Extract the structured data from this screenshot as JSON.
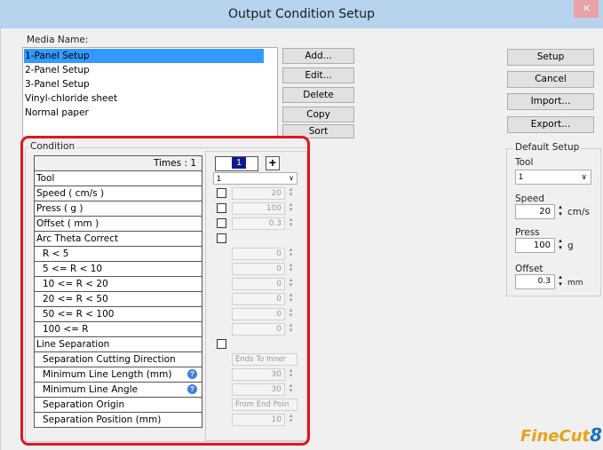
{
  "window": {
    "title": "Output Condition Setup",
    "close_glyph": "✕"
  },
  "media": {
    "label": "Media Name:",
    "items": [
      "1-Panel Setup",
      "2-Panel Setup",
      "3-Panel Setup",
      "Vinyl-chloride sheet",
      "Normal paper"
    ],
    "selected_index": 0
  },
  "list_buttons": {
    "add": "Add...",
    "edit": "Edit...",
    "delete": "Delete",
    "copy": "Copy",
    "sort": "Sort"
  },
  "right_buttons": {
    "setup": "Setup",
    "cancel": "Cancel",
    "import": "Import...",
    "export": "Export..."
  },
  "condition": {
    "group_label": "Condition",
    "times_label": "Times : 1",
    "pass_number": "1",
    "add_pass_glyph": "+",
    "rows": {
      "tool": "Tool",
      "speed": "Speed ( cm/s )",
      "press": "Press ( g )",
      "offset": "Offset ( mm )",
      "arc": "Arc Theta Correct",
      "r1": "R < 5",
      "r2": "5 <= R < 10",
      "r3": "10 <= R < 20",
      "r4": "20 <= R < 50",
      "r5": "50 <= R < 100",
      "r6": "100 <= R",
      "line_sep": "Line Separation",
      "sep_dir": "Separation Cutting Direction",
      "min_len": "Minimum Line Length (mm)",
      "min_angle": "Minimum Line Angle",
      "sep_origin": "Separation Origin",
      "sep_pos": "Separation Position (mm)"
    },
    "values": {
      "tool": "1",
      "speed": "20",
      "press": "100",
      "offset": "0.3",
      "r1": "0",
      "r2": "0",
      "r3": "0",
      "r4": "0",
      "r5": "0",
      "r6": "0",
      "sep_dir": "Ends To Inner",
      "min_len": "30",
      "min_angle": "30",
      "sep_origin": "From End Poin",
      "sep_pos": "10"
    },
    "help_glyph": "?"
  },
  "default_setup": {
    "label": "Default Setup",
    "tool_label": "Tool",
    "tool_value": "1",
    "speed_label": "Speed",
    "speed_value": "20",
    "speed_unit": "cm/s",
    "press_label": "Press",
    "press_value": "100",
    "press_unit": "g",
    "offset_label": "Offset",
    "offset_value": "0.3",
    "offset_unit": "mm"
  },
  "logo": {
    "text_a": "Fine",
    "text_b": "Cut",
    "text_c": "8",
    "color_a": "#e8a317",
    "color_b": "#1f6fbf"
  },
  "highlight_color": "#e0161e"
}
